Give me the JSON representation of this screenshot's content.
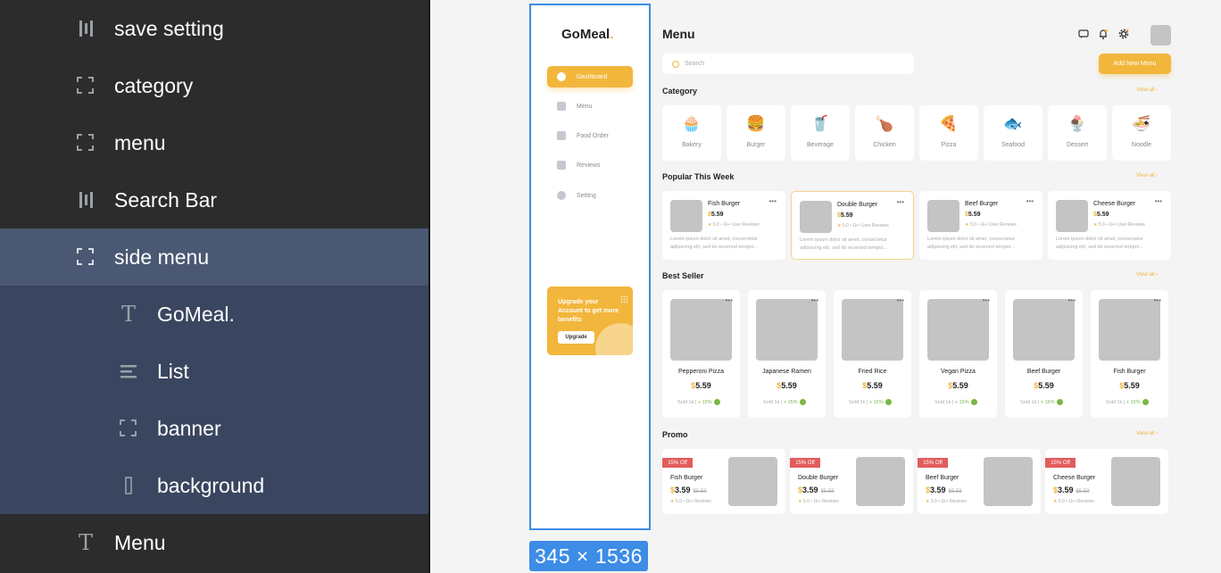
{
  "layers": {
    "items": [
      {
        "label": "save setting",
        "icon": "column-layout-icon"
      },
      {
        "label": "category",
        "icon": "frame-icon"
      },
      {
        "label": "menu",
        "icon": "frame-icon"
      },
      {
        "label": "Search Bar",
        "icon": "column-layout-icon"
      },
      {
        "label": "side menu",
        "icon": "frame-icon"
      },
      {
        "label": "GoMeal.",
        "icon": "text-icon"
      },
      {
        "label": "List",
        "icon": "list-icon"
      },
      {
        "label": "banner",
        "icon": "frame-icon"
      },
      {
        "label": "background",
        "icon": "rectangle-icon"
      },
      {
        "label": "Menu",
        "icon": "text-icon"
      }
    ]
  },
  "selection": {
    "size_label": "345 × 1536"
  },
  "sidebar": {
    "logo": "GoMeal",
    "logo_dot": ".",
    "nav": [
      "Dashboard",
      "Menu",
      "Food Order",
      "Reviews",
      "Setting"
    ],
    "banner_text": "Upgrade your Account to get more benefits",
    "banner_button": "Upgrade"
  },
  "header": {
    "title": "Menu",
    "search_placeholder": "Search",
    "add_button": "Add New Menu"
  },
  "sections": {
    "category": "Category",
    "popular": "Popular This Week",
    "best": "Best Seller",
    "promo": "Promo",
    "view_all": "View all"
  },
  "categories": [
    "Bakery",
    "Burger",
    "Beverage",
    "Chicken",
    "Pizza",
    "Seafood",
    "Dessert",
    "Noodle"
  ],
  "popular": [
    {
      "name": "Fish Burger",
      "price": "5.59",
      "rating": "5.0",
      "reviews": "1k+ User Reviews"
    },
    {
      "name": "Double Burger",
      "price": "5.59",
      "rating": "5.0",
      "reviews": "1k+ User Reviews"
    },
    {
      "name": "Beef Burger",
      "price": "5.59",
      "rating": "5.0",
      "reviews": "1k+ User Reviews"
    },
    {
      "name": "Cheese Burger",
      "price": "5.59",
      "rating": "5.0",
      "reviews": "1k+ User Reviews"
    }
  ],
  "popular_desc": "Lorem ipsum dolor sit amet, consectetur adipiscing elit, sed do eiusmod tempor...",
  "best_sellers": [
    {
      "name": "Pepperoni Pizza",
      "price": "5.59",
      "sold": "Sold 1k",
      "pct": "+ 15%"
    },
    {
      "name": "Japanese Ramen",
      "price": "5.59",
      "sold": "Sold 1k",
      "pct": "+ 15%"
    },
    {
      "name": "Fried Rice",
      "price": "5.59",
      "sold": "Sold 1k",
      "pct": "+ 15%"
    },
    {
      "name": "Vegan Pizza",
      "price": "5.59",
      "sold": "Sold 1k",
      "pct": "+ 15%"
    },
    {
      "name": "Beef Burger",
      "price": "5.59",
      "sold": "Sold 1k",
      "pct": "+ 15%"
    },
    {
      "name": "Fish Burger",
      "price": "5.59",
      "sold": "Sold 1k",
      "pct": "+ 15%"
    }
  ],
  "promos": [
    {
      "badge": "15% Off",
      "name": "Fish Burger",
      "price": "3.59",
      "old": "$5.59",
      "rating": "5.0",
      "reviews": "1k+ Reviews"
    },
    {
      "badge": "15% Off",
      "name": "Double Burger",
      "price": "3.59",
      "old": "$5.59",
      "rating": "5.0",
      "reviews": "1k+ Reviews"
    },
    {
      "badge": "15% Off",
      "name": "Beef Burger",
      "price": "3.59",
      "old": "$5.59",
      "rating": "5.0",
      "reviews": "1k+ Reviews"
    },
    {
      "badge": "15% Off",
      "name": "Cheese Burger",
      "price": "3.59",
      "old": "$5.59",
      "rating": "5.0",
      "reviews": "1k+ Reviews"
    }
  ],
  "currency": "$",
  "colors": {
    "accent": "#f2b63c",
    "selection": "#3d8ce6",
    "badge": "#e25c5c",
    "growth": "#7ab648"
  }
}
